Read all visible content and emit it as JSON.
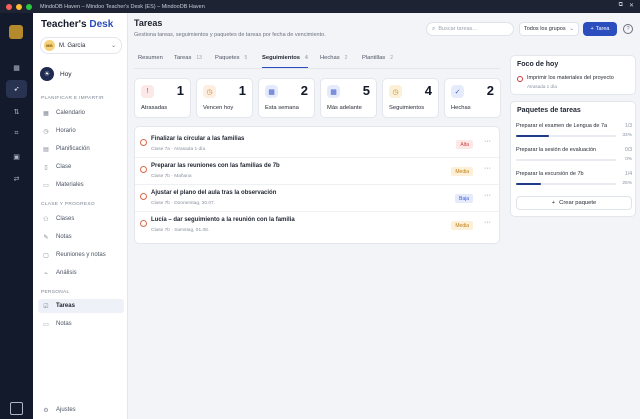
{
  "window": {
    "title": "MindoDB Haven – Mindoo Teacher's Desk (ES) – MindooDB Haven",
    "traffic_colors": [
      "#ff5f57",
      "#febc2e",
      "#28c840"
    ]
  },
  "rail": {
    "icons": [
      "grid-icon",
      "rocket-icon",
      "transfer-icon",
      "scan-icon",
      "screen-icon",
      "sliders-icon"
    ]
  },
  "sidebar": {
    "app_title_a": "Teacher's ",
    "app_title_b": "Desk",
    "user": {
      "initials": "MG",
      "name": "M. García"
    },
    "today": "Hoy",
    "sections": [
      {
        "title": "Planificar e impartir",
        "items": [
          "Calendario",
          "Horario",
          "Planificación",
          "Clase",
          "Materiales"
        ]
      },
      {
        "title": "Clase y progreso",
        "items": [
          "Clases",
          "Notas",
          "Reuniones y notas",
          "Análisis"
        ]
      },
      {
        "title": "Personal",
        "items": [
          "Tareas",
          "Notas"
        ]
      }
    ],
    "settings": "Ajustes"
  },
  "header": {
    "title": "Tareas",
    "subtitle": "Gestiona tareas, seguimientos y paquetes de tareas por fecha de vencimiento.",
    "search_placeholder": "Buscar tareas...",
    "group_filter": "Todos los grupos",
    "add_label": "Tarea"
  },
  "tabs": [
    {
      "label": "Resumen",
      "count": ""
    },
    {
      "label": "Tareas",
      "count": "13"
    },
    {
      "label": "Paquetes",
      "count": "5"
    },
    {
      "label": "Seguimientos",
      "count": "4"
    },
    {
      "label": "Hechas",
      "count": "2"
    },
    {
      "label": "Plantillas",
      "count": "2"
    }
  ],
  "stats": [
    {
      "label": "Atrasadas",
      "value": "1",
      "icon": "alert-icon",
      "color": "#d23c3c",
      "bg": "#fde8e8"
    },
    {
      "label": "Vencen hoy",
      "value": "1",
      "icon": "clock-icon",
      "color": "#e07a1f",
      "bg": "#fdefe1"
    },
    {
      "label": "Esta semana",
      "value": "2",
      "icon": "calendar-icon",
      "color": "#3b5bcc",
      "bg": "#e6ebfb"
    },
    {
      "label": "Más adelante",
      "value": "5",
      "icon": "calendar-icon",
      "color": "#3b5bcc",
      "bg": "#e6ebfb"
    },
    {
      "label": "Seguimientos",
      "value": "4",
      "icon": "clock-icon",
      "color": "#c98a12",
      "bg": "#fcf1d8"
    },
    {
      "label": "Hechas",
      "value": "2",
      "icon": "check-icon",
      "color": "#3b5bcc",
      "bg": "#e6ebfb"
    }
  ],
  "tasks": [
    {
      "title": "Finalizar la circular a las familias",
      "meta": "Clase 7a · Atrasada 1 día",
      "priority": "Alta",
      "pcolor": "#d23c3c",
      "pbg": "#fde8e8"
    },
    {
      "title": "Preparar las reuniones con las familias de 7b",
      "meta": "Clase 7b · Mañana",
      "priority": "Media",
      "pcolor": "#c27a10",
      "pbg": "#fcf1d8"
    },
    {
      "title": "Ajustar el plano del aula tras la observación",
      "meta": "Clase 7b · Donnerstag, 30.07.",
      "priority": "Baja",
      "pcolor": "#3b5bcc",
      "pbg": "#e6ebfb"
    },
    {
      "title": "Lucía – dar seguimiento a la reunión con la familia",
      "meta": "Clase 7b · Samstag, 01.08.",
      "priority": "Media",
      "pcolor": "#c27a10",
      "pbg": "#fcf1d8"
    }
  ],
  "focus": {
    "title": "Foco de hoy",
    "item": "Imprimir los materiales del proyecto",
    "meta": "Atrasada 1 día"
  },
  "packages": {
    "title": "Paquetes de tareas",
    "items": [
      {
        "name": "Preparar el examen de Lengua de 7a",
        "frac": "1/3",
        "pct": "33%",
        "progress": 0.33
      },
      {
        "name": "Preparar la sesión de evaluación",
        "frac": "0/3",
        "pct": "0%",
        "progress": 0
      },
      {
        "name": "Preparar la excursión de 7b",
        "frac": "1/4",
        "pct": "25%",
        "progress": 0.25
      }
    ],
    "create_label": "Crear paquete"
  }
}
